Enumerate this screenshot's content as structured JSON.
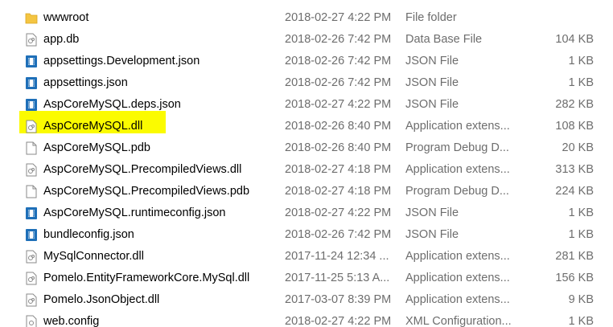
{
  "files": [
    {
      "name": "wwwroot",
      "date": "2018-02-27 4:22 PM",
      "type": "File folder",
      "size": "",
      "icon": "folder-icon"
    },
    {
      "name": "app.db",
      "date": "2018-02-26 7:42 PM",
      "type": "Data Base File",
      "size": "104 KB",
      "icon": "generic-file-icon"
    },
    {
      "name": "appsettings.Development.json",
      "date": "2018-02-26 7:42 PM",
      "type": "JSON File",
      "size": "1 KB",
      "icon": "json-file-icon"
    },
    {
      "name": "appsettings.json",
      "date": "2018-02-26 7:42 PM",
      "type": "JSON File",
      "size": "1 KB",
      "icon": "json-file-icon"
    },
    {
      "name": "AspCoreMySQL.deps.json",
      "date": "2018-02-27 4:22 PM",
      "type": "JSON File",
      "size": "282 KB",
      "icon": "json-file-icon"
    },
    {
      "name": "AspCoreMySQL.dll",
      "date": "2018-02-26 8:40 PM",
      "type": "Application extens...",
      "size": "108 KB",
      "icon": "dll-file-icon",
      "highlighted": true
    },
    {
      "name": "AspCoreMySQL.pdb",
      "date": "2018-02-26 8:40 PM",
      "type": "Program Debug D...",
      "size": "20 KB",
      "icon": "blank-file-icon"
    },
    {
      "name": "AspCoreMySQL.PrecompiledViews.dll",
      "date": "2018-02-27 4:18 PM",
      "type": "Application extens...",
      "size": "313 KB",
      "icon": "dll-file-icon"
    },
    {
      "name": "AspCoreMySQL.PrecompiledViews.pdb",
      "date": "2018-02-27 4:18 PM",
      "type": "Program Debug D...",
      "size": "224 KB",
      "icon": "blank-file-icon"
    },
    {
      "name": "AspCoreMySQL.runtimeconfig.json",
      "date": "2018-02-27 4:22 PM",
      "type": "JSON File",
      "size": "1 KB",
      "icon": "json-file-icon"
    },
    {
      "name": "bundleconfig.json",
      "date": "2018-02-26 7:42 PM",
      "type": "JSON File",
      "size": "1 KB",
      "icon": "json-file-icon"
    },
    {
      "name": "MySqlConnector.dll",
      "date": "2017-11-24 12:34 ...",
      "type": "Application extens...",
      "size": "281 KB",
      "icon": "dll-file-icon"
    },
    {
      "name": "Pomelo.EntityFrameworkCore.MySql.dll",
      "date": "2017-11-25 5:13 A...",
      "type": "Application extens...",
      "size": "156 KB",
      "icon": "dll-file-icon"
    },
    {
      "name": "Pomelo.JsonObject.dll",
      "date": "2017-03-07 8:39 PM",
      "type": "Application extens...",
      "size": "9 KB",
      "icon": "dll-file-icon"
    },
    {
      "name": "web.config",
      "date": "2018-02-27 4:22 PM",
      "type": "XML Configuration...",
      "size": "1 KB",
      "icon": "config-file-icon"
    }
  ],
  "colors": {
    "highlight": "#fbfb00",
    "json_icon": "#1e6fb8",
    "folder": "#f4c542",
    "secondary_text": "#6d6d6d"
  }
}
